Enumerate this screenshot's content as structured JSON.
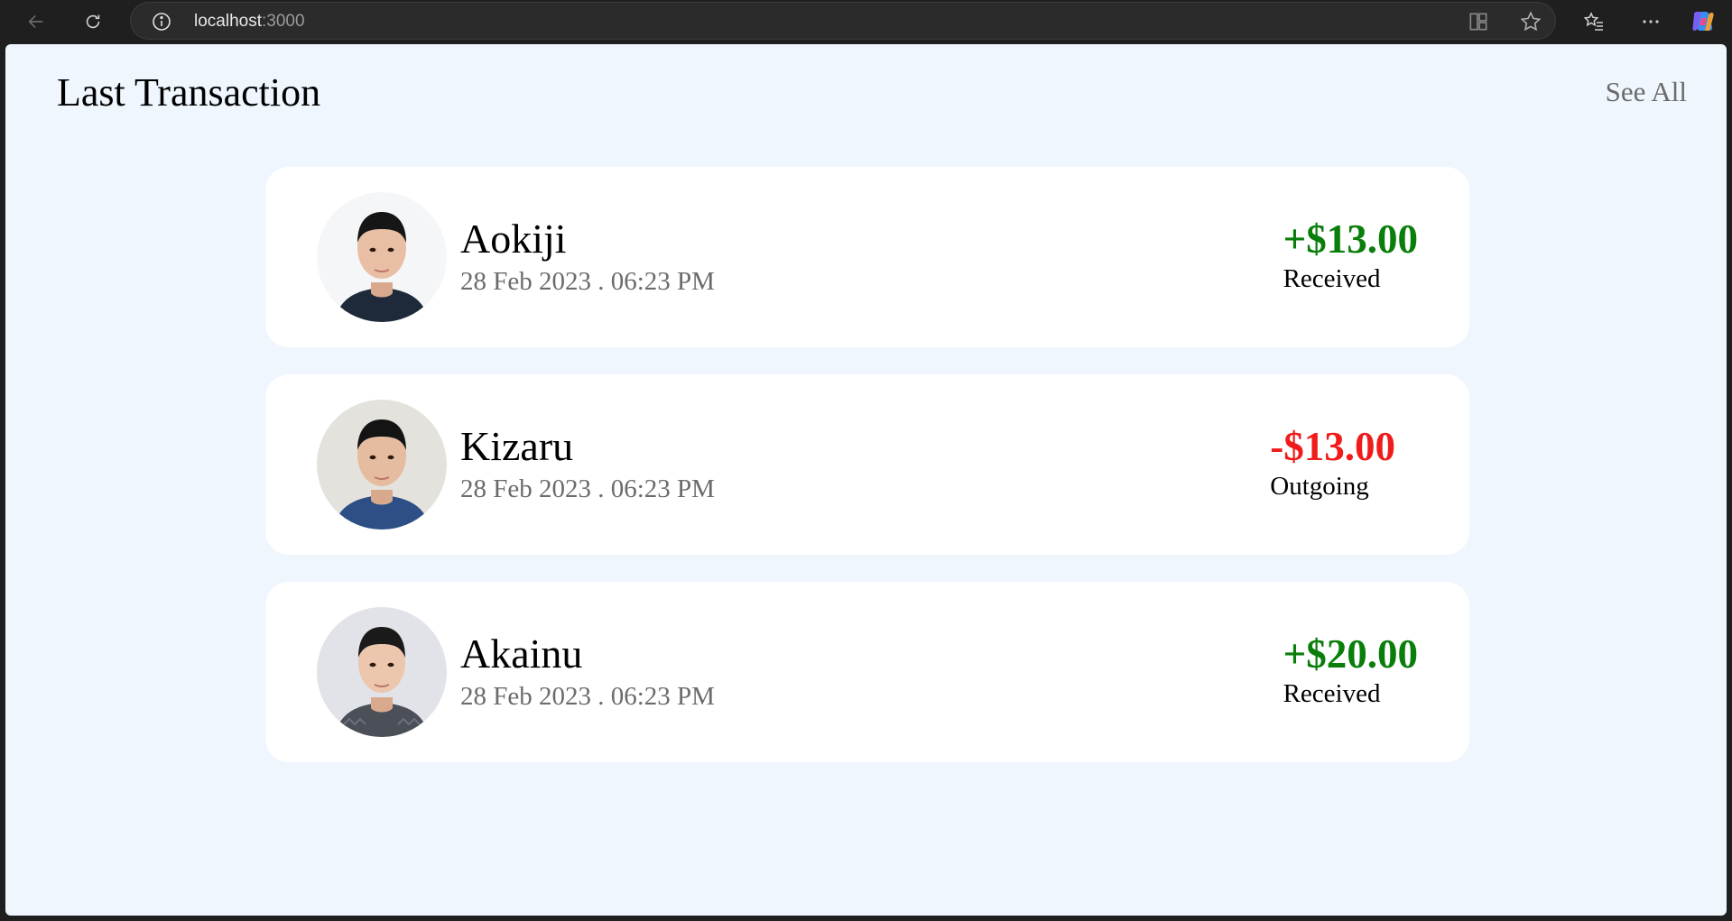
{
  "browser": {
    "url_host": "localhost",
    "url_port": ":3000"
  },
  "page": {
    "title": "Last Transaction",
    "see_all_label": "See All"
  },
  "transactions": [
    {
      "name": "Aokiji",
      "date": "28 Feb 2023 . 06:23 PM",
      "amount": "+$13.00",
      "status": "Received",
      "direction": "positive"
    },
    {
      "name": "Kizaru",
      "date": "28 Feb 2023 . 06:23 PM",
      "amount": "-$13.00",
      "status": "Outgoing",
      "direction": "negative"
    },
    {
      "name": "Akainu",
      "date": "28 Feb 2023 . 06:23 PM",
      "amount": "+$20.00",
      "status": "Received",
      "direction": "positive"
    }
  ],
  "colors": {
    "positive": "#0a7e0a",
    "negative": "#f01c1c",
    "background": "#eff6fe"
  },
  "icons": [
    "back-arrow-icon",
    "reload-icon",
    "info-icon",
    "split-screen-icon",
    "star-icon",
    "favorites-icon",
    "more-icon",
    "copilot-icon"
  ]
}
